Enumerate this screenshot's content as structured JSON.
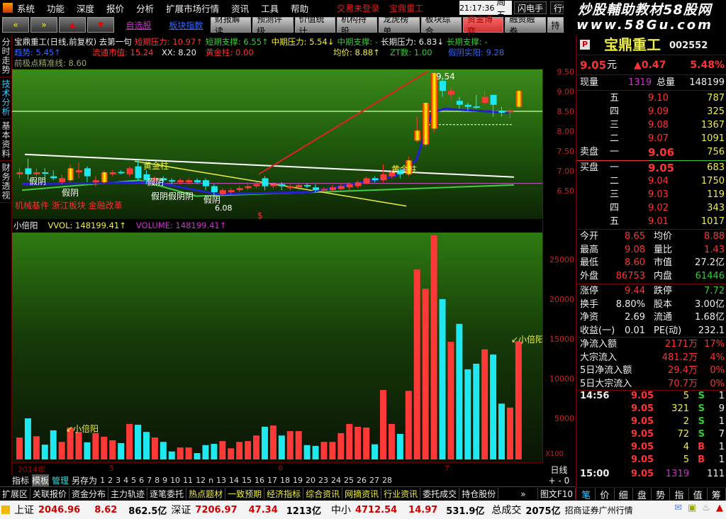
{
  "menu": {
    "items": [
      "系统",
      "功能",
      "深度",
      "报价",
      "分析",
      "扩展市场行情",
      "资讯",
      "工具",
      "帮助"
    ],
    "status1": "交易未登录",
    "status2": "宝鼎重工",
    "time": "21:17:36",
    "weekday": "周五",
    "btn1": "闪电手",
    "btn2": "行情"
  },
  "watermark": {
    "line1": "炒股輔助教材58股网",
    "line2": "www.58Gu.com"
  },
  "toolbar": {
    "back": "«",
    "fwd": "»",
    "up": "▲",
    "down": "▼",
    "items": [
      "自选股",
      "板块指数",
      "财报解读",
      "预测评级",
      "价值统计",
      "机构持股",
      "龙虎榜单",
      "板块综合",
      "资金博弈",
      "融资融券",
      "持"
    ]
  },
  "lefttabs": [
    "分时走势",
    "技术分析",
    "基本资料",
    "财务透视"
  ],
  "header": {
    "title": "宝鼎重工(日线,前复权) 去第一句",
    "l1": [
      "短期压力: 10.97↑",
      "短期支撑: 6.55↑",
      "中期压力: 5.54↓",
      "中期支撑: -",
      "长期压力: 6.83↓",
      "长期支撑: -"
    ],
    "l2": [
      "趋势: 5.45↑",
      "流通市值: 15.24",
      "XX: 8.20",
      "黄金柱: 0.00",
      "均价: 8.88↑",
      "ZT数: 1.00",
      "假阴实阳: 9.28"
    ],
    "l3": "前极点精准线: 8.60"
  },
  "chart_labels": {
    "fake_yin": "假阴",
    "fake_yin2": "假阴假阴阴",
    "golden": "黄金柱",
    "high": "9.54",
    "low": "6.08",
    "dollar": "$",
    "sector": "机械基件 浙江板块 金融改革"
  },
  "price_axis": [
    "9.50",
    "9.00",
    "8.50",
    "8.00",
    "7.50",
    "7.00",
    "6.50"
  ],
  "volume": {
    "name": "小倍阳",
    "vol": "VVOL: 148199.41↑",
    "volume": "VOLUME: 148199.41↑",
    "marker": "↙小倍阳",
    "axis": [
      "25000",
      "20000",
      "15000",
      "10000",
      "5000"
    ],
    "unit": "X100"
  },
  "dates": [
    "2014年",
    "5",
    "6",
    "7"
  ],
  "indexrow": {
    "items": [
      "指标",
      "模板",
      "管理",
      "另存为"
    ],
    "nums": [
      "1",
      "2",
      "3",
      "4",
      "5",
      "6",
      "7",
      "8",
      "9",
      "10",
      "11",
      "12",
      "n",
      "13",
      "14",
      "15",
      "16",
      "17",
      "18",
      "19",
      "20",
      "23",
      "24",
      "25",
      "26",
      "27",
      "28"
    ],
    "period": "日线",
    "zoom": "+ - 0"
  },
  "extrow": {
    "items": [
      "扩展区",
      "关联报价",
      "资金分布",
      "主力轨迹",
      "逐笔委托",
      "热点题材",
      "一致预期",
      "经济指标",
      "综合资讯",
      "网摘资讯",
      "行业资讯",
      "委托成交",
      "持仓股份"
    ],
    "more": "»",
    "f10": "图文F10"
  },
  "status": {
    "sh_label": "上证",
    "sh": "2046.96",
    "sh_chg": "8.62",
    "sh_amt": "862.5亿",
    "sz_label": "深证",
    "sz": "7206.97",
    "sz_chg": "47.34",
    "sz_amt": "1213亿",
    "zx_label": "中小",
    "zx": "4712.54",
    "zx_chg": "14.97",
    "zx_amt": "531.9亿",
    "total_label": "总成交",
    "total": "2075亿",
    "broker": "招商证券广州行情"
  },
  "quote": {
    "badge": "P",
    "name": "宝鼎重工",
    "code": "002552",
    "price": "9.05",
    "unit": "元",
    "change": "▲0.47",
    "pct": "5.48%",
    "cur_label": "现量",
    "cur": "1319",
    "tot_label": "总量",
    "tot": "148199",
    "sell_label": "卖盘",
    "buy_label": "买盘",
    "sells": [
      {
        "lv": "五",
        "p": "9.10",
        "v": "787"
      },
      {
        "lv": "四",
        "p": "9.09",
        "v": "325"
      },
      {
        "lv": "三",
        "p": "9.08",
        "v": "1367"
      },
      {
        "lv": "二",
        "p": "9.07",
        "v": "1091"
      },
      {
        "lv": "一",
        "p": "9.06",
        "v": "756"
      }
    ],
    "buys": [
      {
        "lv": "一",
        "p": "9.05",
        "v": "683"
      },
      {
        "lv": "二",
        "p": "9.04",
        "v": "1750"
      },
      {
        "lv": "三",
        "p": "9.03",
        "v": "119"
      },
      {
        "lv": "四",
        "p": "9.02",
        "v": "343"
      },
      {
        "lv": "五",
        "p": "9.01",
        "v": "1017"
      }
    ],
    "stats": [
      [
        "今开",
        "8.65",
        "均价",
        "8.88"
      ],
      [
        "最高",
        "9.08",
        "量比",
        "1.43"
      ],
      [
        "最低",
        "8.60",
        "市值",
        "27.2亿"
      ],
      [
        "外盘",
        "86753",
        "内盘",
        "61446"
      ],
      [
        "涨停",
        "9.44",
        "跌停",
        "7.72"
      ],
      [
        "换手",
        "8.80%",
        "股本",
        "3.00亿"
      ],
      [
        "净资",
        "2.69",
        "流通",
        "1.68亿"
      ],
      [
        "收益(一)",
        "0.01",
        "PE(动)",
        "232.1"
      ]
    ],
    "flows": [
      [
        "净流入额",
        "2171万",
        "17%"
      ],
      [
        "大宗流入",
        "481.2万",
        "4%"
      ],
      [
        "5日净流入额",
        "29.4万",
        "0%"
      ],
      [
        "5日大宗流入",
        "70.7万",
        "0%"
      ]
    ],
    "ticks": [
      [
        "14:56",
        "9.05",
        "5",
        "S",
        "1"
      ],
      [
        "",
        "9.05",
        "321",
        "S",
        "9"
      ],
      [
        "",
        "9.05",
        "2",
        "S",
        "1"
      ],
      [
        "",
        "9.05",
        "72",
        "S",
        "7"
      ],
      [
        "",
        "9.05",
        "4",
        "B",
        "1"
      ],
      [
        "",
        "9.05",
        "5",
        "B",
        "1"
      ],
      [
        "15:00",
        "9.05",
        "1319",
        "",
        "111"
      ]
    ],
    "tabs": [
      "笔",
      "价",
      "细",
      "盘",
      "势",
      "指",
      "值",
      "筹"
    ]
  },
  "chart_data": {
    "type": "candlestick+bar",
    "price_range": [
      6.2,
      9.6
    ],
    "volume_range": [
      0,
      29000
    ],
    "candles": [
      [
        6.95,
        7.0,
        7.1,
        6.85
      ],
      [
        7.1,
        6.95,
        7.35,
        6.8
      ],
      [
        6.95,
        7.0,
        7.1,
        6.9
      ],
      [
        7.0,
        6.98,
        7.1,
        6.85
      ],
      [
        6.9,
        6.85,
        7.05,
        6.8
      ],
      [
        6.75,
        6.85,
        6.95,
        6.7
      ],
      [
        6.8,
        7.1,
        7.2,
        6.75
      ],
      [
        7.0,
        7.05,
        7.25,
        6.85
      ],
      [
        7.1,
        6.9,
        7.15,
        6.75
      ],
      [
        6.75,
        6.8,
        6.9,
        6.65
      ],
      [
        6.75,
        7.0,
        7.05,
        6.7
      ],
      [
        6.95,
        7.0,
        7.05,
        6.9
      ],
      [
        7.0,
        7.01,
        7.05,
        6.95
      ],
      [
        6.95,
        7.1,
        7.15,
        6.9
      ],
      [
        7.15,
        6.85,
        7.3,
        6.8
      ],
      [
        6.95,
        6.8,
        7.05,
        6.7
      ],
      [
        6.8,
        6.85,
        6.9,
        6.75
      ],
      [
        6.85,
        6.8,
        6.9,
        6.75
      ],
      [
        6.8,
        6.78,
        6.85,
        6.7
      ],
      [
        6.75,
        6.8,
        6.85,
        6.7
      ],
      [
        6.75,
        6.8,
        6.85,
        6.7
      ],
      [
        6.8,
        6.75,
        6.85,
        6.7
      ],
      [
        6.8,
        6.65,
        6.85,
        6.55
      ],
      [
        6.65,
        6.5,
        6.7,
        6.4
      ],
      [
        6.45,
        6.55,
        6.6,
        6.4
      ],
      [
        6.5,
        6.55,
        6.6,
        6.45
      ],
      [
        6.55,
        6.6,
        6.65,
        6.5
      ],
      [
        6.6,
        6.65,
        6.7,
        6.55
      ],
      [
        6.65,
        6.7,
        6.75,
        6.6
      ],
      [
        6.85,
        6.65,
        6.9,
        6.55
      ],
      [
        6.65,
        6.7,
        6.75,
        6.6
      ],
      [
        6.7,
        6.65,
        6.75,
        6.55
      ],
      [
        6.6,
        6.65,
        6.7,
        6.55
      ],
      [
        6.62,
        6.68,
        6.72,
        6.55
      ],
      [
        6.68,
        6.65,
        6.72,
        6.6
      ],
      [
        6.62,
        6.55,
        6.7,
        6.5
      ],
      [
        6.55,
        6.58,
        6.62,
        6.5
      ],
      [
        6.55,
        6.62,
        6.68,
        6.5
      ],
      [
        6.58,
        6.65,
        6.72,
        6.55
      ],
      [
        6.62,
        6.7,
        6.75,
        6.55
      ],
      [
        6.65,
        6.75,
        6.8,
        6.6
      ],
      [
        6.72,
        6.85,
        6.9,
        6.7
      ],
      [
        6.85,
        6.8,
        6.9,
        6.75
      ],
      [
        6.8,
        6.95,
        7.2,
        6.75
      ],
      [
        6.9,
        7.0,
        7.05,
        6.85
      ],
      [
        7.05,
        6.95,
        7.1,
        6.85
      ],
      [
        6.95,
        7.3,
        7.4,
        6.9
      ],
      [
        7.8,
        8.05,
        8.4,
        7.75
      ],
      [
        7.7,
        8.75,
        8.75,
        7.65
      ],
      [
        8.1,
        9.5,
        9.54,
        8.0
      ],
      [
        9.3,
        9.05,
        9.4,
        8.9
      ],
      [
        8.95,
        9.05,
        9.15,
        8.85
      ],
      [
        8.8,
        8.7,
        8.9,
        8.6
      ],
      [
        8.7,
        8.65,
        8.75,
        8.55
      ],
      [
        8.65,
        8.66,
        8.95,
        8.6
      ],
      [
        8.75,
        8.9,
        9.05,
        8.7
      ],
      [
        8.95,
        8.7,
        8.95,
        8.4
      ],
      [
        8.55,
        8.5,
        8.65,
        8.4
      ],
      [
        8.52,
        8.55,
        8.6,
        8.35
      ],
      [
        8.65,
        9.05,
        9.08,
        8.6
      ]
    ],
    "volumes": [
      2750,
      5150,
      2900,
      1850,
      3650,
      2200,
      4000,
      3450,
      2150,
      3300,
      2850,
      2400,
      2050,
      4450,
      4350,
      3450,
      2750,
      2200,
      1000,
      1500,
      1500,
      800,
      1800,
      1950,
      2300,
      1400,
      2200,
      2300,
      3000,
      4100,
      4250,
      3000,
      3550,
      3550,
      1800,
      1700,
      2200,
      2200,
      3300,
      4450,
      4100,
      4000,
      1900,
      8700,
      4450,
      3200,
      8600,
      23800,
      21400,
      28100,
      20100,
      14750,
      17000,
      11300,
      12000,
      13800,
      13150,
      7000,
      6500,
      14820
    ],
    "volume_up": [
      1,
      0,
      1,
      0,
      0,
      1,
      1,
      1,
      0,
      1,
      1,
      1,
      0,
      1,
      0,
      0,
      1,
      0,
      0,
      1,
      1,
      0,
      0,
      0,
      1,
      1,
      1,
      1,
      1,
      0,
      1,
      0,
      1,
      1,
      0,
      0,
      1,
      1,
      1,
      1,
      1,
      1,
      0,
      1,
      1,
      0,
      1,
      1,
      1,
      1,
      0,
      1,
      0,
      0,
      0,
      1,
      0,
      0,
      1,
      1
    ],
    "colors": {
      "up": "#ff3838",
      "down": "#20e8f0"
    }
  }
}
